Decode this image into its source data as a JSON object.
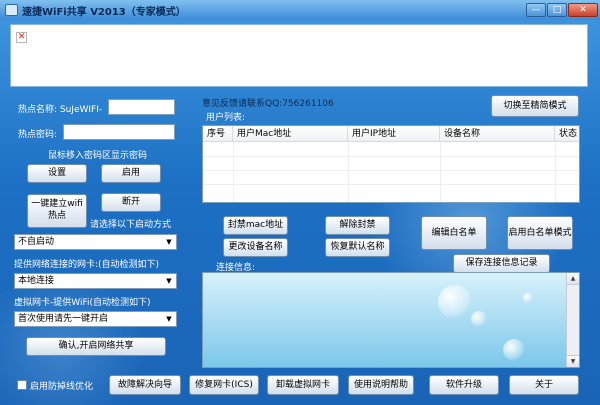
{
  "window": {
    "title": "速捷WiFi共享 V2013（专家模式）",
    "minimize_glyph": "—",
    "maximize_glyph": "□",
    "close_glyph": "✕"
  },
  "banner": {
    "broken_image_glyph": "✕"
  },
  "hotspot": {
    "name_label": "热点名称: SuJeWIFI-",
    "name_value": "",
    "password_label": "热点密码:",
    "password_value": "",
    "password_hint": "鼠标移入密码区显示密码",
    "set_button": "设置",
    "enable_button": "启用",
    "one_click_button": "一键建立wifi热点",
    "disconnect_button": "断开",
    "startup_label": "请选择以下启动方式",
    "startup_value": "不自启动"
  },
  "network": {
    "provide_label": "提供网络连接的网卡:(自动检测如下)",
    "provide_value": "本地连接",
    "virtual_label": "虚拟网卡-提供WiFi(自动检测如下)",
    "virtual_value": "首次使用请先一键开启",
    "confirm_button": "确认,开启网络共享"
  },
  "feedback": "意见反馈请联系QQ:756261106",
  "switch_mode_button": "切换至精简模式",
  "user_list": {
    "title": "用户列表:",
    "columns": [
      "序号",
      "用户Mac地址",
      "用户IP地址",
      "设备名称",
      "状态"
    ]
  },
  "actions": {
    "ban_mac": "封禁mac地址",
    "unban": "解除封禁",
    "rename_device": "更改设备名称",
    "restore_name": "恢复默认名称",
    "edit_whitelist": "编辑白名单",
    "enable_whitelist": "启用白名单模式",
    "save_log": "保存连接信息记录"
  },
  "connection_info": {
    "title": "连接信息:"
  },
  "footer": {
    "anti_drop_label": "启用防掉线优化",
    "anti_drop_checked": false,
    "troubleshoot": "故障解决向导",
    "repair_nic": "修复网卡(ICS)",
    "uninstall_nic": "卸载虚拟网卡",
    "help": "使用说明帮助",
    "upgrade": "软件升级",
    "about": "关于"
  }
}
